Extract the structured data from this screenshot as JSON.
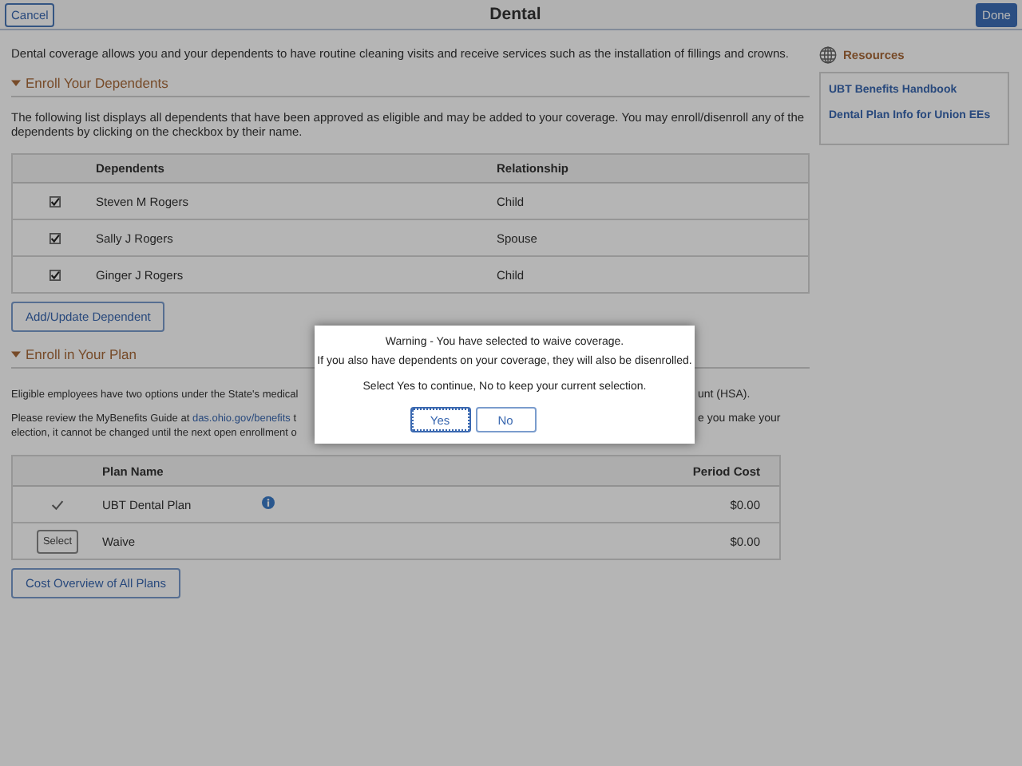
{
  "header": {
    "cancel": "Cancel",
    "title": "Dental",
    "done": "Done"
  },
  "intro": "Dental coverage allows you and your dependents to have routine cleaning visits and receive services such as the installation of fillings and crowns.",
  "dependents_section": {
    "title": "Enroll Your Dependents",
    "expanded": true,
    "description": "The following list displays all dependents that have been approved as eligible and may be added to your coverage. You may enroll/disenroll any of the dependents by clicking on the checkbox by their name.",
    "columns": [
      "Dependents",
      "Relationship"
    ],
    "rows": [
      {
        "checked": true,
        "name": "Steven M Rogers",
        "relationship": "Child"
      },
      {
        "checked": true,
        "name": "Sally J Rogers",
        "relationship": "Spouse"
      },
      {
        "checked": true,
        "name": "Ginger J Rogers",
        "relationship": "Child"
      }
    ],
    "button": "Add/Update Dependent"
  },
  "plan_section": {
    "title": "Enroll in Your Plan",
    "expanded": true,
    "paragraph_1": {
      "left": "Eligible employees have two options under the State's medical",
      "right": "unt (HSA)."
    },
    "paragraph_2": {
      "left_prefix": "Please review the MyBenefits Guide at ",
      "link": "das.ohio.gov/benefits",
      "left_suffix": " t",
      "right": "e you make your",
      "line_2": "election, it cannot be changed until the next open enrollment o"
    },
    "columns": [
      "Plan Name",
      "Period Cost"
    ],
    "rows": [
      {
        "selected": true,
        "name": "UBT Dental Plan",
        "info": true,
        "cost": "$0.00"
      },
      {
        "selected": false,
        "select_label": "Select",
        "name": "Waive",
        "info": false,
        "cost": "$0.00"
      }
    ],
    "button": "Cost Overview of All Plans"
  },
  "resources": {
    "title": "Resources",
    "links": [
      "UBT Benefits Handbook",
      "Dental Plan Info for Union EEs"
    ]
  },
  "dialog": {
    "lines": [
      "Warning - You have selected to waive coverage.",
      "If you also have dependents on your coverage, they will also be disenrolled.",
      "Select Yes to continue, No to keep your current selection."
    ],
    "buttons": [
      {
        "label": "Yes",
        "focused": true
      },
      {
        "label": "No",
        "focused": false
      }
    ]
  }
}
